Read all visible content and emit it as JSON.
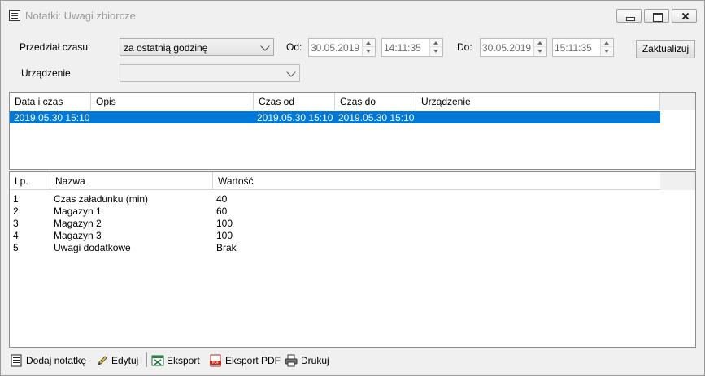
{
  "window": {
    "title": "Notatki: Uwagi zbiorcze"
  },
  "filters": {
    "range_label": "Przedział czasu:",
    "range_value": "za ostatnią godzinę",
    "from_label": "Od:",
    "from_date": "30.05.2019",
    "from_time": "14:11:35",
    "to_label": "Do:",
    "to_date": "30.05.2019",
    "to_time": "15:11:35",
    "update_button": "Zaktualizuj",
    "device_label": "Urządzenie",
    "device_value": ""
  },
  "notes_table": {
    "columns": [
      "Data i czas",
      "Opis",
      "Czas od",
      "Czas do",
      "Urządzenie"
    ],
    "rows": [
      {
        "data_i_czas": "2019.05.30 15:10",
        "opis": "",
        "czas_od": "2019.05.30 15:10",
        "czas_do": "2019.05.30 15:10",
        "urzadzenie": ""
      }
    ]
  },
  "details_table": {
    "columns": [
      "Lp.",
      "Nazwa",
      "Wartość"
    ],
    "rows": [
      {
        "lp": "1",
        "nazwa": "Czas załadunku (min)",
        "wartosc": "40"
      },
      {
        "lp": "2",
        "nazwa": "Magazyn 1",
        "wartosc": "60"
      },
      {
        "lp": "3",
        "nazwa": "Magazyn 2",
        "wartosc": "100"
      },
      {
        "lp": "4",
        "nazwa": "Magazyn 3",
        "wartosc": "100"
      },
      {
        "lp": "5",
        "nazwa": "Uwagi dodatkowe",
        "wartosc": "Brak"
      }
    ]
  },
  "toolbar": {
    "add_note": "Dodaj notatkę",
    "edit": "Edytuj",
    "export": "Eksport",
    "export_pdf": "Eksport PDF",
    "print": "Drukuj"
  },
  "icons": {
    "add_note": "notepad-icon",
    "edit": "pencil-icon",
    "export": "excel-icon",
    "export_pdf": "pdf-icon",
    "print": "printer-icon"
  },
  "colors": {
    "selection": "#0078d7",
    "window_bg": "#f0f0f0",
    "title_text": "#9a9a9a"
  }
}
